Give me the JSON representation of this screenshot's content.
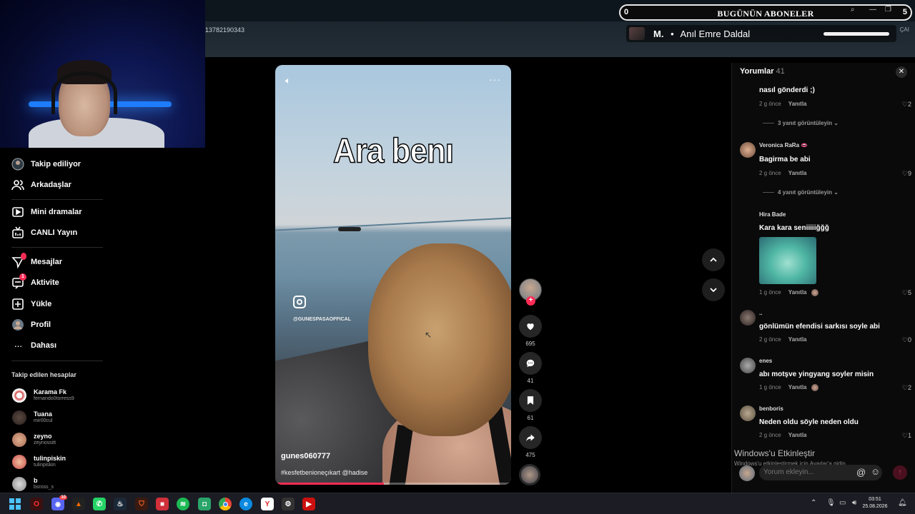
{
  "browser": {
    "url_fragment": "13782190343",
    "right_text": "ÇAI"
  },
  "subscriber_widget": {
    "title": "BUGÜNÜN ABONELER",
    "count_left": "0",
    "count_right": "5",
    "latest_tier": "M.",
    "latest_name": "Anıl Emre Daldal"
  },
  "sidebar": {
    "nav": [
      {
        "label": "Takip ediliyor",
        "icon": "following-icon"
      },
      {
        "label": "Arkadaşlar",
        "icon": "friends-icon"
      },
      {
        "label": "Mini dramalar",
        "icon": "mini-drama-icon"
      },
      {
        "label": "CANLI Yayın",
        "icon": "live-icon"
      },
      {
        "label": "Mesajlar",
        "icon": "messages-icon",
        "badge": ""
      },
      {
        "label": "Aktivite",
        "icon": "activity-icon",
        "badge": "1"
      },
      {
        "label": "Yükle",
        "icon": "upload-icon"
      },
      {
        "label": "Profil",
        "icon": "profile-icon"
      },
      {
        "label": "Dahası",
        "icon": "more-icon"
      }
    ],
    "following_title": "Takip edilen hesaplar",
    "accounts": [
      {
        "name": "Karama Fk",
        "handle": "fernando0torress9",
        "color": "#d8d8d8"
      },
      {
        "name": "Tuana",
        "handle": "mir00cul",
        "color": "#3a3030"
      },
      {
        "name": "zeyno",
        "handle": "zeynossitt",
        "color": "#a86a54"
      },
      {
        "name": "tulinpiskin",
        "handle": "tulinpiskin",
        "color": "#c84a4a"
      },
      {
        "name": "b",
        "handle": "bsross_s",
        "color": "#bbbbbb"
      }
    ]
  },
  "video": {
    "overlay_text": "Ara benı",
    "ig_handle": "@GUNESPASAOFFICAL",
    "author": "gunes060777",
    "tags": "#kesfetbenioneçıkart @hadise",
    "progress": 0.46
  },
  "actions": {
    "likes": "695",
    "comments": "41",
    "saves": "61",
    "shares": "475"
  },
  "comments_panel": {
    "title": "Yorumlar",
    "count": "41",
    "reply_label": "Yanıtla",
    "items": [
      {
        "text": "nasıl gönderdi ;)",
        "time": "2 g önce",
        "likes": "2"
      },
      {
        "replies": "3 yanıt görüntüleyin ⌄"
      },
      {
        "user": "Veronica RaRa 👄",
        "text": "Bagirma be abi",
        "time": "2 g önce",
        "likes": "9"
      },
      {
        "replies": "4 yanıt görüntüleyin ⌄"
      },
      {
        "user": "Hira Bade",
        "text": "Kara kara seniiiiiğğğ",
        "time": "1 g önce",
        "likes": "5"
      },
      {
        "user": "..",
        "text": "gönlümün efendisi sarkısı soyle abi",
        "time": "2 g önce",
        "likes": "0"
      },
      {
        "user": "enes",
        "text": "abı motşve yingyang soyler misin",
        "time": "1 g önce",
        "likes": "2"
      },
      {
        "user": "benboris",
        "text": "Neden oldu söyle neden oldu",
        "time": "2 g önce",
        "likes": "1"
      }
    ],
    "input_placeholder": "Yorum ekleyin...",
    "watermark_title": "Windows'u Etkinleştir",
    "watermark_sub": "Windows'u etkinleştirmek için Ayarlar'a gidin."
  },
  "taskbar": {
    "time": "03:51",
    "date": "25.08.2026",
    "discord_badge": "10"
  }
}
